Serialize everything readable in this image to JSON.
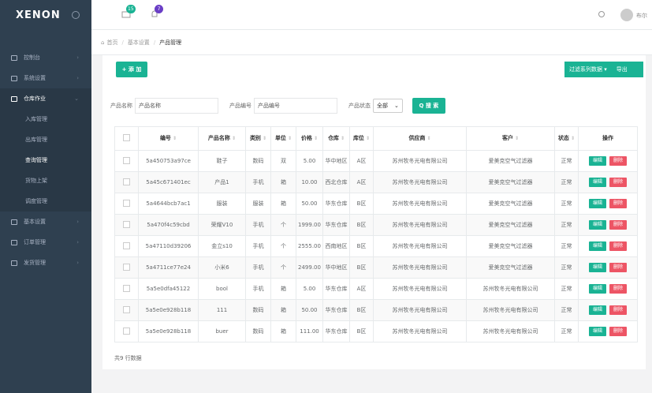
{
  "app": {
    "logo": "XENON",
    "user": "布尔"
  },
  "badges": {
    "messages": "15",
    "alerts": "7"
  },
  "colors": {
    "primary": "#1ab394",
    "danger": "#ed5565",
    "sidebar": "#2f4050",
    "badge_blue": "#1c84c6",
    "badge_purple": "#6a3ec6"
  },
  "sidebar": {
    "items": [
      {
        "label": "控制台",
        "icon": "dashboard-icon"
      },
      {
        "label": "系统设置",
        "icon": "monitor-icon"
      },
      {
        "label": "仓库作业",
        "icon": "warehouse-icon"
      },
      {
        "label": "入库管理"
      },
      {
        "label": "出库管理"
      },
      {
        "label": "查询管理"
      },
      {
        "label": "货物上架"
      },
      {
        "label": "调度管理"
      },
      {
        "label": "基本设置",
        "icon": "settings-icon"
      },
      {
        "label": "订单管理",
        "icon": "order-icon"
      },
      {
        "label": "发货管理",
        "icon": "ship-icon"
      }
    ]
  },
  "breadcrumb": [
    "首页",
    "基本设置",
    "产品管理"
  ],
  "toolbar": {
    "add": "+ 添 加",
    "filter": "过滤系列数据 ▾",
    "export": "导出"
  },
  "filters": {
    "name_label": "产品名称",
    "name_placeholder": "产品名称",
    "code_label": "产品编号",
    "code_placeholder": "产品编号",
    "status_label": "产品状态",
    "status_value": "全部",
    "search": "Q 搜 索"
  },
  "table": {
    "headers": [
      "编号",
      "产品名称",
      "类别",
      "单位",
      "价格",
      "仓库",
      "库位",
      "供应商",
      "客户",
      "状态",
      "操作"
    ],
    "edit": "编辑",
    "del": "删除",
    "rows": [
      [
        "5a450753a97ce",
        "鞋子",
        "数码",
        "双",
        "5.00",
        "华中地区",
        "A区",
        "苏州牧冬光电有限公司",
        "爱美克空气过滤器",
        "正常"
      ],
      [
        "5a45c671401ec",
        "产品1",
        "手机",
        "箱",
        "10.00",
        "西北仓库",
        "A区",
        "苏州牧冬光电有限公司",
        "爱美克空气过滤器",
        "正常"
      ],
      [
        "5a4644bcb7ac1",
        "服装",
        "服装",
        "箱",
        "50.00",
        "华东仓库",
        "B区",
        "苏州牧冬光电有限公司",
        "爱美克空气过滤器",
        "正常"
      ],
      [
        "5a470f4c59cbd",
        "荣耀V10",
        "手机",
        "个",
        "1999.00",
        "华东仓库",
        "B区",
        "苏州牧冬光电有限公司",
        "爱美克空气过滤器",
        "正常"
      ],
      [
        "5a47110d39206",
        "金立s10",
        "手机",
        "个",
        "2555.00",
        "西南地区",
        "B区",
        "苏州牧冬光电有限公司",
        "爱美克空气过滤器",
        "正常"
      ],
      [
        "5a4711ce77e24",
        "小米6",
        "手机",
        "个",
        "2499.00",
        "华中地区",
        "B区",
        "苏州牧冬光电有限公司",
        "爱美克空气过滤器",
        "正常"
      ],
      [
        "5a5e0dfa45122",
        "bool",
        "手机",
        "箱",
        "5.00",
        "华东仓库",
        "A区",
        "苏州牧冬光电有限公司",
        "苏州牧冬光电有限公司",
        "正常"
      ],
      [
        "5a5e0e928b118",
        "111",
        "数码",
        "箱",
        "50.00",
        "华东仓库",
        "B区",
        "苏州牧冬光电有限公司",
        "苏州牧冬光电有限公司",
        "正常"
      ],
      [
        "5a5e0e928b118",
        "buer",
        "数码",
        "箱",
        "111.00",
        "华东仓库",
        "B区",
        "苏州牧冬光电有限公司",
        "苏州牧冬光电有限公司",
        "正常"
      ]
    ]
  },
  "footer": {
    "total": "共9 行数据"
  }
}
